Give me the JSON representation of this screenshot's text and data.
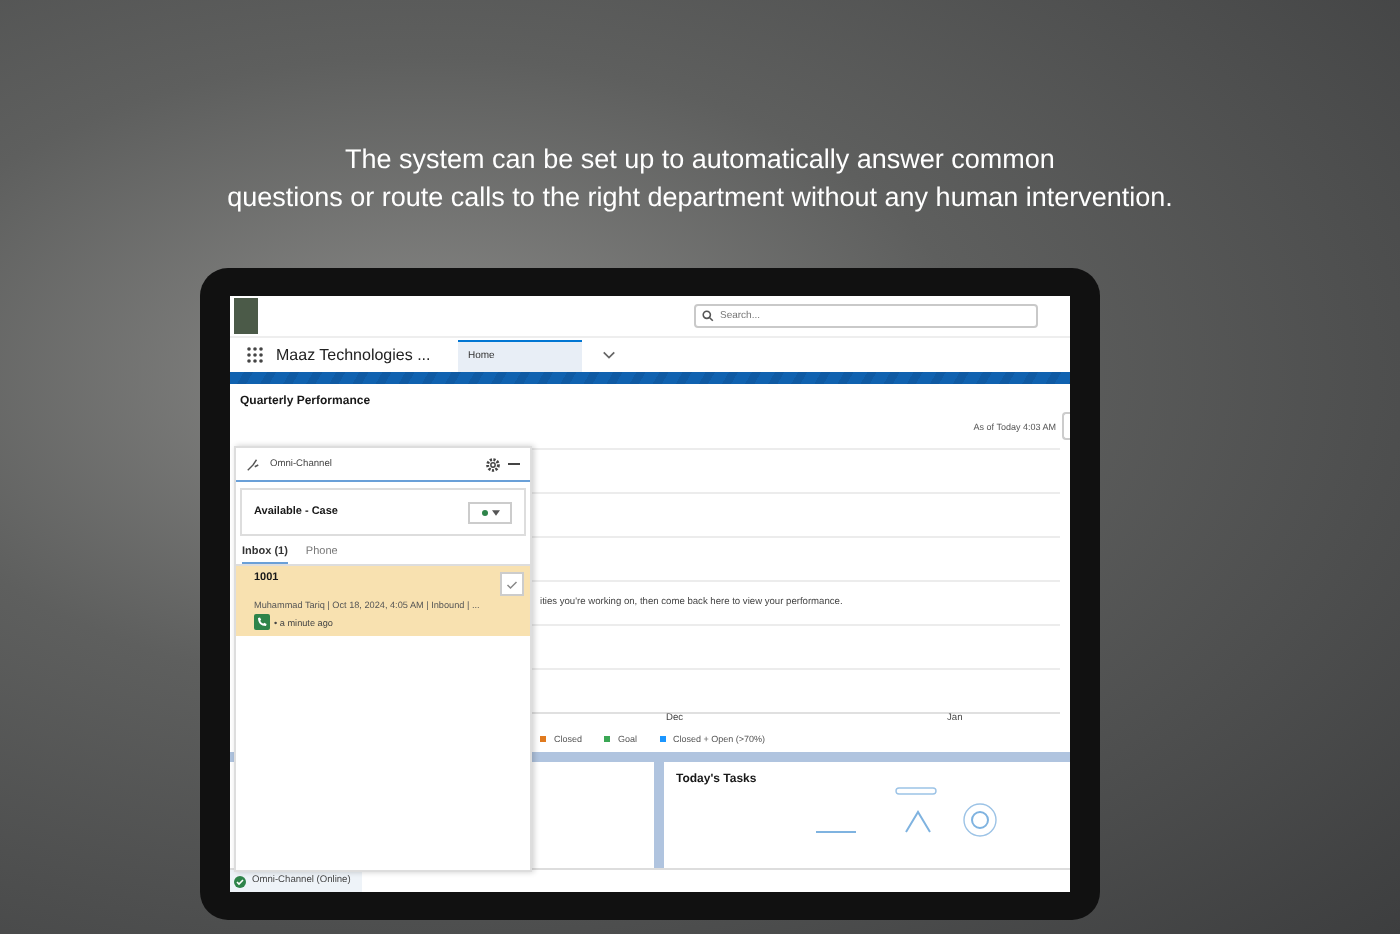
{
  "caption": "The system can be set up to automatically answer common\nquestions or route calls to the right department without any human intervention.",
  "header": {
    "search": {
      "placeholder": "Search..."
    }
  },
  "nav": {
    "app_name": "Maaz Technologies ...",
    "tabs": [
      {
        "label": "Home",
        "selected": true
      }
    ]
  },
  "performance": {
    "title": "Quarterly Performance",
    "as_of": "As of Today 4:03 AM",
    "message": "ities you're working on, then come back here to view your performance.",
    "axis_labels": [
      "Dec",
      "Jan"
    ],
    "legend": [
      {
        "label": "Closed",
        "color": "#e07a1f"
      },
      {
        "label": "Goal",
        "color": "#3ba755"
      },
      {
        "label": "Closed + Open (>70%)",
        "color": "#1b96ff"
      }
    ]
  },
  "tasks": {
    "title": "Today's Tasks"
  },
  "omni": {
    "title": "Omni-Channel",
    "status": {
      "label": "Available - Case",
      "color": "#2e844a"
    },
    "tabs": [
      {
        "label": "Inbox (1)",
        "selected": true
      },
      {
        "label": "Phone",
        "selected": false
      }
    ],
    "work_item": {
      "number": "1001",
      "detail": "Muhammad Tariq | Oct 18, 2024, 4:05 AM | Inbound | ...",
      "time": "• a minute ago"
    }
  },
  "footer": {
    "label": "Omni-Channel (Online)"
  }
}
